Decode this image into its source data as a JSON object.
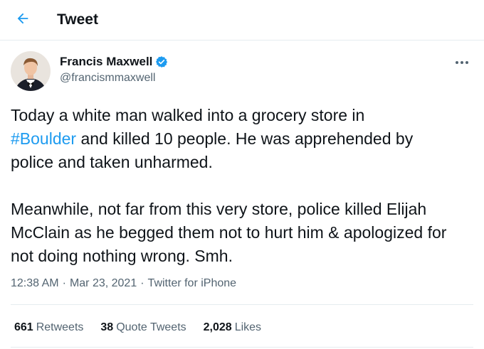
{
  "header": {
    "title": "Tweet",
    "back_icon": "arrow-left-icon"
  },
  "author": {
    "display_name": "Francis Maxwell",
    "handle": "@francismmaxwell",
    "verified_icon": "verified-badge-icon"
  },
  "tweet": {
    "line1_a": "Today a white man walked into a grocery store in",
    "hashtag": "#Boulder",
    "line2_b": " and killed 10 people. He was apprehended by",
    "line3": "police and taken unharmed.",
    "paragraph2": "Meanwhile, not far from this very store, police killed Elijah McClain as he begged them not to hurt him & apologized for not doing nothing wrong. Smh."
  },
  "meta": {
    "time": "12:38 AM",
    "date": "Mar 23, 2021",
    "source": "Twitter for iPhone",
    "separator": "·"
  },
  "stats": {
    "retweets": {
      "count": "661",
      "label": "Retweets"
    },
    "quotes": {
      "count": "38",
      "label": "Quote Tweets"
    },
    "likes": {
      "count": "2,028",
      "label": "Likes"
    }
  },
  "colors": {
    "accent": "#1d9bf0",
    "text": "#0f1419",
    "secondary": "#536471",
    "divider": "#e6ecf0"
  }
}
